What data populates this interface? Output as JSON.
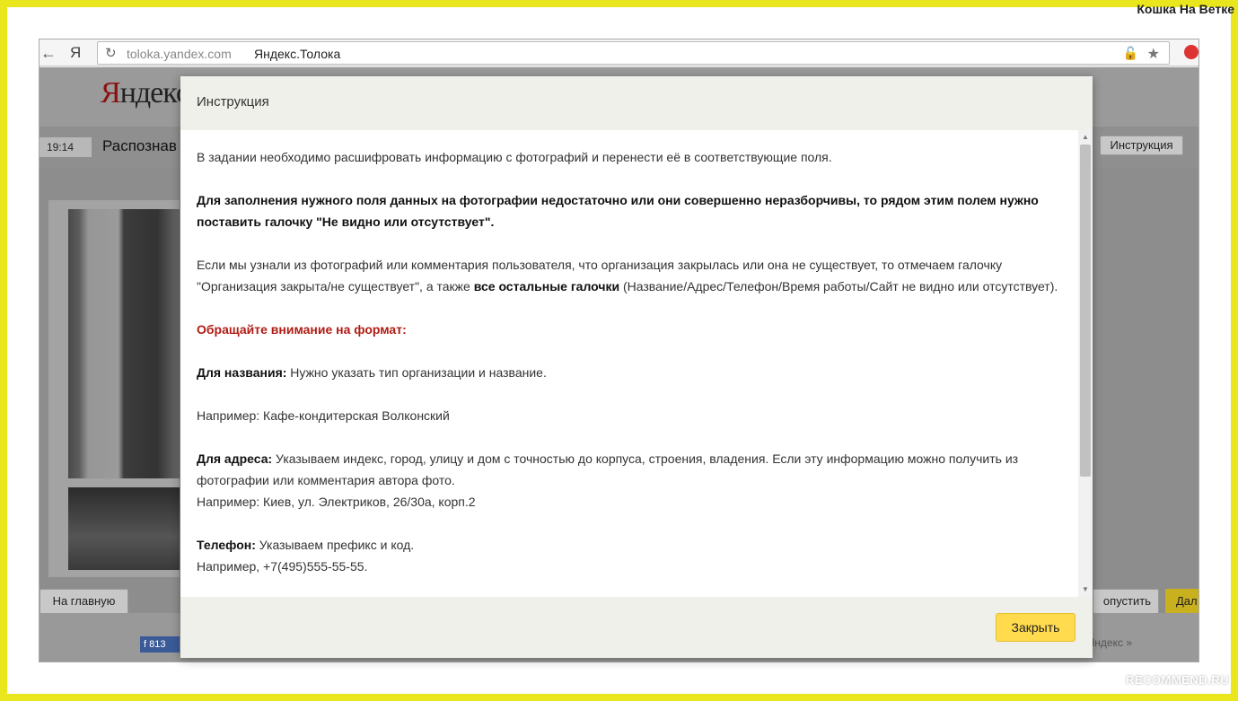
{
  "watermark": "Кошка На Ветке",
  "recommend": "RECOMMEND.RU",
  "browser": {
    "ya": "Я",
    "url_host": "toloka.yandex.com",
    "tab_title": "Яндекс.Толока"
  },
  "page": {
    "logo_first": "Я",
    "logo_rest": "ндекс",
    "timer": "19:14",
    "task_title": "Распознав",
    "instruction_button": "Инструкция",
    "home_button": "На главную",
    "skip_button": "опустить",
    "next_button": "Дал",
    "fb_count": "813",
    "yandex_link": "Яндекс »"
  },
  "modal": {
    "title": "Инструкция",
    "p1": "В задании необходимо расшифровать информацию с фотографий и перенести её в соответствующие поля.",
    "p2": "Для заполнения нужного поля данных на фотографии недостаточно или они совершенно неразборчивы, то рядом этим полем нужно поставить галочку \"Не видно или отсутствует\".",
    "p3_a": "Если мы узнали из фотографий или комментария пользователя, что организация закрылась или она не существует, то отмечаем галочку \"Организация закрыта/не существует\", а также ",
    "p3_b": "все остальные галочки",
    "p3_c": " (Название/Адрес/Телефон/Время работы/Сайт не видно или отсутствует).",
    "attention": "Обращайте внимание на формат:",
    "name_label": "Для названия:",
    "name_text": " Нужно указать тип организации и название.",
    "name_example": "Например: Кафе-кондитерская Волконский",
    "addr_label": "Для адреса:",
    "addr_text": " Указываем индекс, город, улицу и дом с точностью до корпуса, строения, владения. Если эту информацию можно получить из фотографии или комментария автора фото.",
    "addr_example": "Например: Киев, ул. Электриков, 26/30а, корп.2",
    "phone_label": "Телефон:",
    "phone_text": " Указываем префикс и код.",
    "phone_example": "Например, +7(495)555-55-55.",
    "close_button": "Закрыть"
  }
}
